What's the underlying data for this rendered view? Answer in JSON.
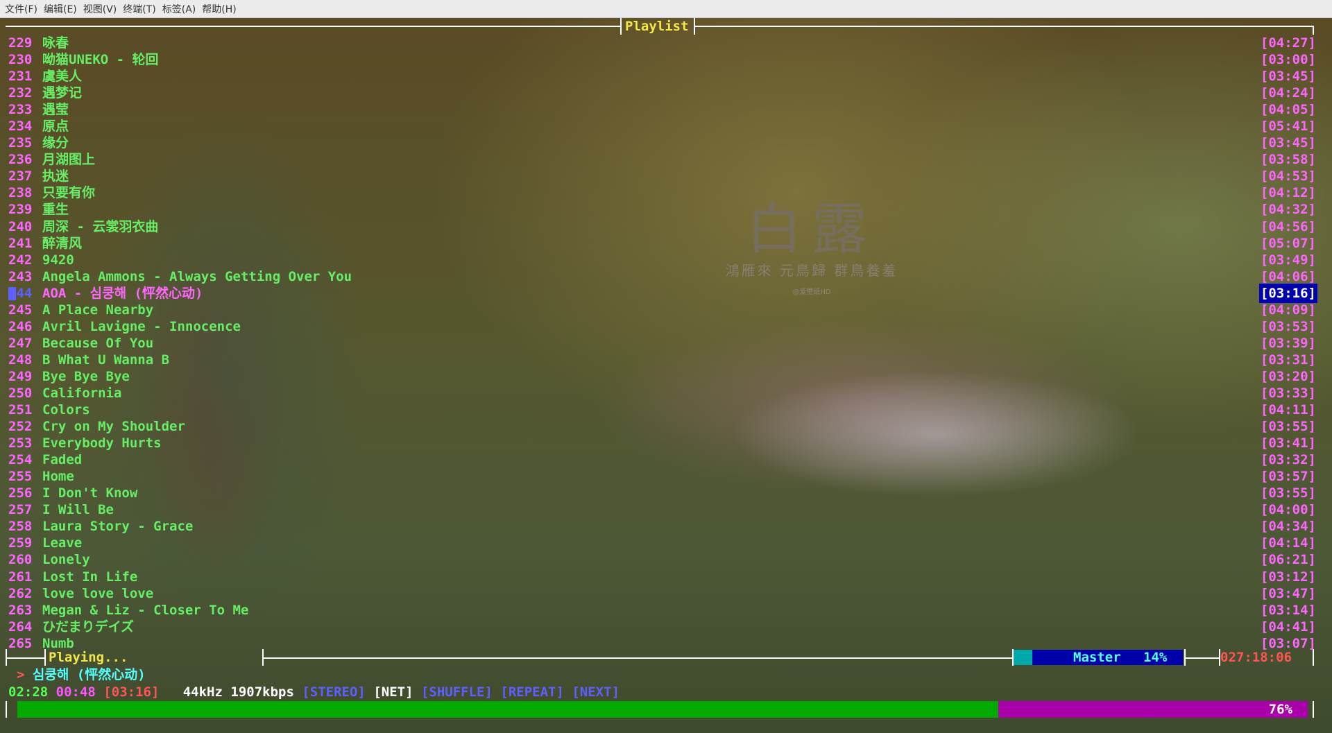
{
  "menu": [
    "文件(F)",
    "编辑(E)",
    "视图(V)",
    "终端(T)",
    "标签(A)",
    "帮助(H)"
  ],
  "window": {
    "title": "Playlist"
  },
  "wallpaper": {
    "title": "白露",
    "subtitle": "鴻雁來 元鳥歸 群鳥養羞",
    "watermark": "@爱壁纸HD"
  },
  "playlist": [
    {
      "num": "229",
      "title": "咏春",
      "duration": "[04:27]"
    },
    {
      "num": "230",
      "title": "呦猫UNEKO - 轮回",
      "duration": "[03:00]"
    },
    {
      "num": "231",
      "title": "虞美人",
      "duration": "[03:45]"
    },
    {
      "num": "232",
      "title": "遇梦记",
      "duration": "[04:24]"
    },
    {
      "num": "233",
      "title": "遇莹",
      "duration": "[04:05]"
    },
    {
      "num": "234",
      "title": "原点",
      "duration": "[05:41]"
    },
    {
      "num": "235",
      "title": "缘分",
      "duration": "[03:45]"
    },
    {
      "num": "236",
      "title": "月湖图上",
      "duration": "[03:58]"
    },
    {
      "num": "237",
      "title": "执迷",
      "duration": "[04:53]"
    },
    {
      "num": "238",
      "title": "只要有你",
      "duration": "[04:12]"
    },
    {
      "num": "239",
      "title": "重生",
      "duration": "[04:32]"
    },
    {
      "num": "240",
      "title": "周深 - 云裳羽衣曲",
      "duration": "[04:56]"
    },
    {
      "num": "241",
      "title": "醉清风",
      "duration": "[05:07]"
    },
    {
      "num": "242",
      "title": "9420",
      "duration": "[03:49]"
    },
    {
      "num": "243",
      "title": "Angela Ammons - Always Getting Over You",
      "duration": "[04:06]"
    },
    {
      "num": "244",
      "title": "AOA - 심쿵해 (怦然心动)",
      "duration": "[03:16]",
      "current": true
    },
    {
      "num": "245",
      "title": "A Place Nearby",
      "duration": "[04:09]"
    },
    {
      "num": "246",
      "title": "Avril Lavigne - Innocence",
      "duration": "[03:53]"
    },
    {
      "num": "247",
      "title": "Because Of You",
      "duration": "[03:39]"
    },
    {
      "num": "248",
      "title": "B What U Wanna B",
      "duration": "[03:31]"
    },
    {
      "num": "249",
      "title": "Bye Bye Bye",
      "duration": "[03:20]"
    },
    {
      "num": "250",
      "title": "California",
      "duration": "[03:33]"
    },
    {
      "num": "251",
      "title": "Colors",
      "duration": "[04:11]"
    },
    {
      "num": "252",
      "title": "Cry on My Shoulder",
      "duration": "[03:55]"
    },
    {
      "num": "253",
      "title": "Everybody Hurts",
      "duration": "[03:41]"
    },
    {
      "num": "254",
      "title": "Faded",
      "duration": "[03:32]"
    },
    {
      "num": "255",
      "title": "Home",
      "duration": "[03:57]"
    },
    {
      "num": "256",
      "title": "I Don't Know",
      "duration": "[03:55]"
    },
    {
      "num": "257",
      "title": "I Will Be",
      "duration": "[04:00]"
    },
    {
      "num": "258",
      "title": "Laura Story - Grace",
      "duration": "[04:34]"
    },
    {
      "num": "259",
      "title": "Leave",
      "duration": "[04:14]"
    },
    {
      "num": "260",
      "title": "Lonely",
      "duration": "[06:21]"
    },
    {
      "num": "261",
      "title": "Lost In Life",
      "duration": "[03:12]"
    },
    {
      "num": "262",
      "title": "love love love",
      "duration": "[03:47]"
    },
    {
      "num": "263",
      "title": "Megan & Liz - Closer To Me",
      "duration": "[03:14]"
    },
    {
      "num": "264",
      "title": "ひだまりデイズ",
      "duration": "[04:41]"
    },
    {
      "num": "265",
      "title": "Numb",
      "duration": "[03:07]"
    }
  ],
  "status": {
    "playing_label": "Playing...",
    "mixer_label": "Master",
    "mixer_volume": "14%",
    "total_time": "027:18:06",
    "now_arrow": ">",
    "now_title": "심쿵해 (怦然心动)",
    "elapsed": "02:28",
    "remaining": "00:48",
    "length": "[03:16]",
    "rate": "44kHz",
    "bitrate": "1907kbps",
    "flag_stereo": "[STEREO]",
    "flag_net": "[NET]",
    "flag_shuffle": "[SHUFFLE]",
    "flag_repeat": "[REPEAT]",
    "flag_next": "[NEXT]",
    "progress_fraction": 0.76,
    "progress_label": "76%"
  },
  "colors": {
    "number": "#ff66ff",
    "title": "#66ee66",
    "selected_bg": "#0000aa",
    "progress_fill": "#00aa00",
    "progress_rest": "#aa00aa"
  }
}
